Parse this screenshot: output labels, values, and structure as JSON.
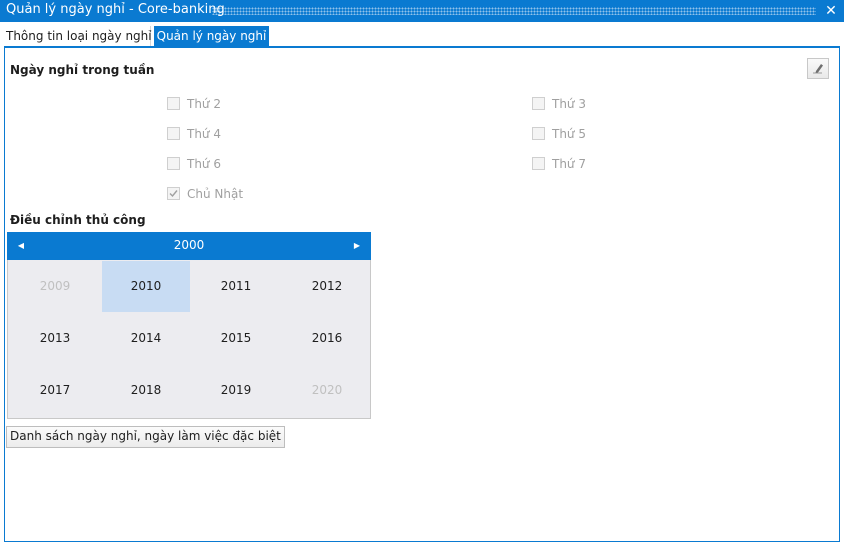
{
  "window": {
    "title": "Quản lý ngày nghỉ - Core-banking"
  },
  "tabs": [
    {
      "label": "Thông tin loại ngày nghỉ",
      "active": false
    },
    {
      "label": "Quản lý ngày nghỉ",
      "active": true
    }
  ],
  "weekly": {
    "title": "Ngày nghỉ trong tuần",
    "days": [
      {
        "label": "Thứ 2",
        "checked": false
      },
      {
        "label": "Thứ 3",
        "checked": false
      },
      {
        "label": "Thứ 4",
        "checked": false
      },
      {
        "label": "Thứ 5",
        "checked": false
      },
      {
        "label": "Thứ 6",
        "checked": false
      },
      {
        "label": "Thứ 7",
        "checked": false
      },
      {
        "label": "Chủ Nhật",
        "checked": true
      }
    ]
  },
  "manual": {
    "title": "Điều chỉnh thủ công",
    "calendar": {
      "header": "2000",
      "years": [
        {
          "label": "2009",
          "dim": true,
          "selected": false
        },
        {
          "label": "2010",
          "dim": false,
          "selected": true
        },
        {
          "label": "2011",
          "dim": false,
          "selected": false
        },
        {
          "label": "2012",
          "dim": false,
          "selected": false
        },
        {
          "label": "2013",
          "dim": false,
          "selected": false
        },
        {
          "label": "2014",
          "dim": false,
          "selected": false
        },
        {
          "label": "2015",
          "dim": false,
          "selected": false
        },
        {
          "label": "2016",
          "dim": false,
          "selected": false
        },
        {
          "label": "2017",
          "dim": false,
          "selected": false
        },
        {
          "label": "2018",
          "dim": false,
          "selected": false
        },
        {
          "label": "2019",
          "dim": false,
          "selected": false
        },
        {
          "label": "2020",
          "dim": true,
          "selected": false
        }
      ]
    },
    "list_button": "Danh sách ngày nghỉ, ngày làm việc đặc biệt"
  },
  "icons": {
    "close": "close-icon",
    "edit": "pencil-icon",
    "prev": "triangle-left-icon",
    "next": "triangle-right-icon"
  },
  "colors": {
    "accent": "#0a7ad1",
    "selected": "#c8dcf3",
    "calendar_bg": "#ececf0"
  }
}
